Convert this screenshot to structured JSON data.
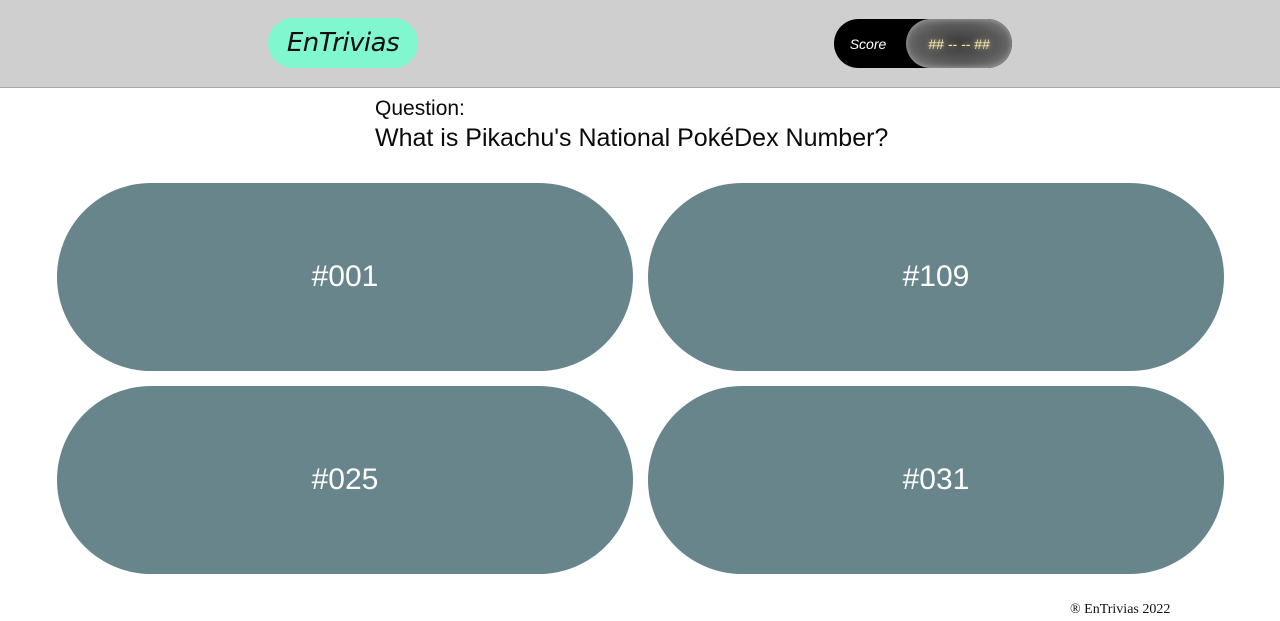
{
  "header": {
    "logo": "EnTrivias",
    "score_label": "Score",
    "score_value": "## -- -- ##"
  },
  "question": {
    "label": "Question:",
    "text": "What is Pikachu's National PokéDex Number?"
  },
  "answers": [
    {
      "label": "#001"
    },
    {
      "label": "#109"
    },
    {
      "label": "#025"
    },
    {
      "label": "#031"
    }
  ],
  "footer": {
    "copyright": "® EnTrivias 2022"
  },
  "colors": {
    "header_bg": "#cfcfcf",
    "logo_bg": "#80f7cf",
    "answer_bg": "#68858b",
    "score_bg": "#000000"
  }
}
